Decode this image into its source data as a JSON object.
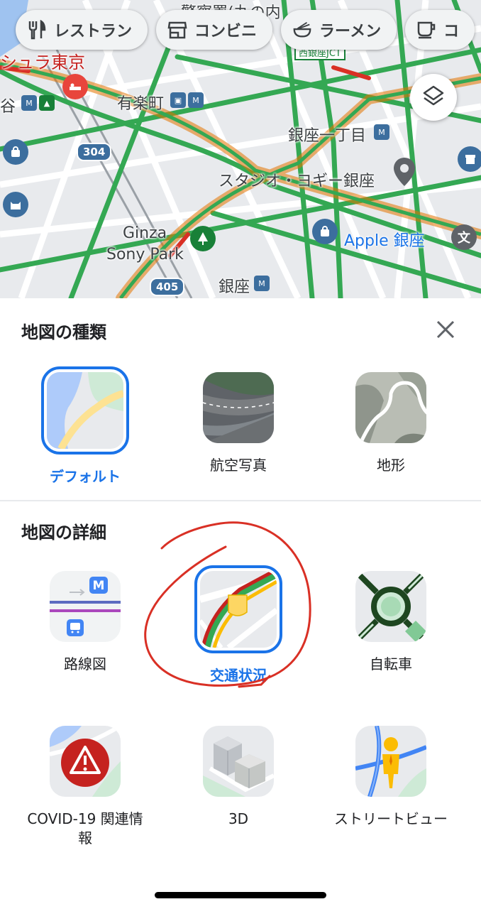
{
  "chips": [
    {
      "label": "レストラン",
      "icon": "fork-knife-icon"
    },
    {
      "label": "コンビニ",
      "icon": "store-icon"
    },
    {
      "label": "ラーメン",
      "icon": "ramen-icon"
    },
    {
      "label": "コ",
      "icon": "coffee-icon"
    }
  ],
  "map": {
    "labels": {
      "police": "警察署(丸の内",
      "hotel": "シュラ東京",
      "yurakucho": "有楽町",
      "ginza_itchome": "銀座一丁目",
      "studio": "スタジオ・ヨギー銀座",
      "ginza_sony_park_1": "Ginza",
      "ginza_sony_park_2": "Sony Park",
      "apple": "Apple 銀座",
      "ginza": "銀座",
      "left_cut": "谷",
      "jct": "西銀座JCT"
    },
    "routes": {
      "r304": "304",
      "r405": "405"
    },
    "layers_icon": "layers-icon"
  },
  "sheet": {
    "map_type_title": "地図の種類",
    "map_detail_title": "地図の詳細",
    "close_icon": "close-icon",
    "map_types": [
      {
        "label": "デフォルト",
        "selected": true
      },
      {
        "label": "航空写真",
        "selected": false
      },
      {
        "label": "地形",
        "selected": false
      }
    ],
    "details": [
      {
        "label": "路線図",
        "selected": false
      },
      {
        "label": "交通状況",
        "selected": true
      },
      {
        "label": "自転車",
        "selected": false
      },
      {
        "label": "COVID-19 関連情報",
        "selected": false
      },
      {
        "label": "3D",
        "selected": false
      },
      {
        "label": "ストリートビュー",
        "selected": false
      }
    ],
    "transit_badge": "M"
  },
  "colors": {
    "accent": "#1a73e8",
    "annotation": "#d93025"
  }
}
